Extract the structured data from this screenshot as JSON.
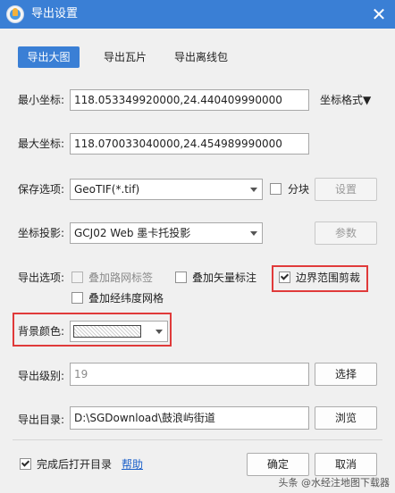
{
  "window": {
    "title": "导出设置",
    "close_glyph": "✕"
  },
  "tabs": [
    {
      "label": "导出大图",
      "active": true
    },
    {
      "label": "导出瓦片",
      "active": false
    },
    {
      "label": "导出离线包",
      "active": false
    }
  ],
  "min_coord": {
    "label": "最小坐标:",
    "value": "118.053349920000,24.440409990000"
  },
  "max_coord": {
    "label": "最大坐标:",
    "value": "118.070033040000,24.454989990000"
  },
  "coord_format": {
    "label": "坐标格式▼"
  },
  "save_option": {
    "label": "保存选项:",
    "value": "GeoTIF(*.tif)",
    "split_label": "分块",
    "split_checked": false,
    "settings_label": "设置"
  },
  "projection": {
    "label": "坐标投影:",
    "value": "GCJ02 Web 墨卡托投影",
    "params_label": "参数"
  },
  "export_options": {
    "label": "导出选项:",
    "road_labels": {
      "label": "叠加路网标签",
      "checked": false,
      "disabled": true
    },
    "vector_labels": {
      "label": "叠加矢量标注",
      "checked": false,
      "disabled": false
    },
    "clip_boundary": {
      "label": "边界范围剪裁",
      "checked": true,
      "disabled": false
    },
    "graticule": {
      "label": "叠加经纬度网格",
      "checked": false,
      "disabled": false
    }
  },
  "background": {
    "label": "背景颜色:"
  },
  "export_level": {
    "label": "导出级别:",
    "value": "19",
    "select_label": "选择"
  },
  "export_dir": {
    "label": "导出目录:",
    "value": "D:\\SGDownload\\鼓浪屿街道",
    "browse_label": "浏览"
  },
  "footer": {
    "open_after_label": "完成后打开目录",
    "open_after_checked": true,
    "help_label": "帮助",
    "ok_label": "确定",
    "cancel_label": "取消"
  },
  "watermark": "头条 @水经注地图下载器",
  "colors": {
    "accent": "#3a7fd5",
    "highlight_box": "#e03a3a",
    "link": "#1a5fc9"
  }
}
